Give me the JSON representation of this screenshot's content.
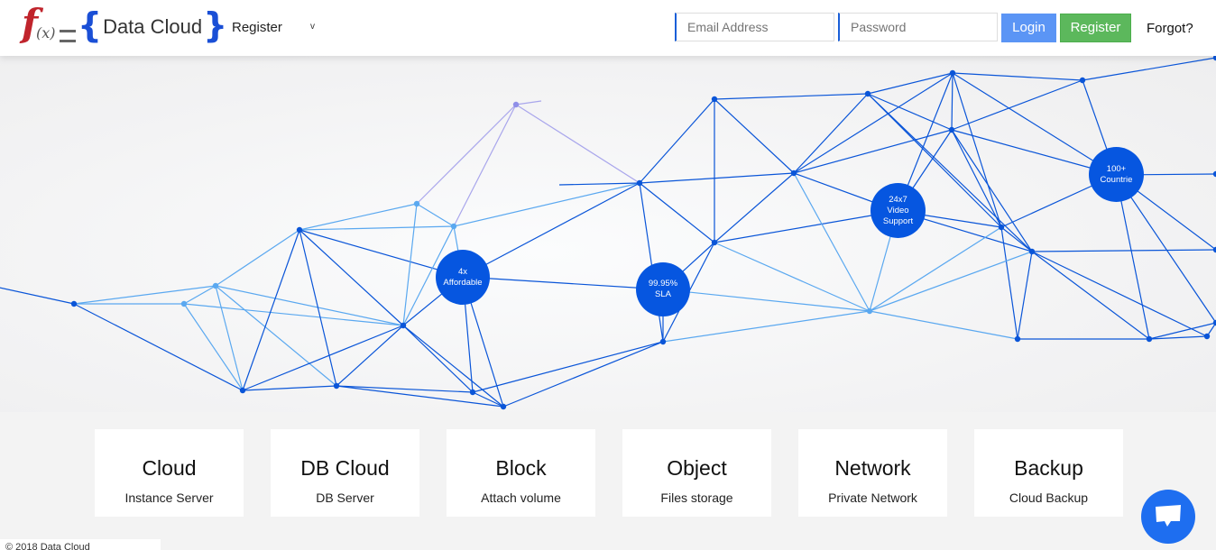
{
  "header": {
    "brand": {
      "open_brace": "{",
      "name": "Data Cloud",
      "close_brace": "}",
      "logo_f": "f",
      "logo_x": "(x)"
    },
    "nav": {
      "register_label": "Register",
      "chevron": "⌄"
    },
    "login_form": {
      "email_placeholder": "Email Address",
      "password_placeholder": "Password",
      "login_label": "Login",
      "register_label": "Register",
      "forgot_label": "Forgot?"
    }
  },
  "hero": {
    "bubbles": [
      {
        "line1": "4x",
        "line2": "Affordable",
        "line3": ""
      },
      {
        "line1": "99.95%",
        "line2": "SLA",
        "line3": ""
      },
      {
        "line1": "24x7",
        "line2": "Video",
        "line3": "Support"
      },
      {
        "line1": "100+",
        "line2": "Countrie",
        "line3": ""
      }
    ],
    "colors": {
      "bubble": "#0656e0",
      "line": "#0a55d8",
      "light_line": "#5aa8f0",
      "purple_node": "#8f8fe8"
    }
  },
  "services": [
    {
      "title": "Cloud",
      "subtitle": "Instance Server"
    },
    {
      "title": "DB Cloud",
      "subtitle": "DB Server"
    },
    {
      "title": "Block",
      "subtitle": "Attach volume"
    },
    {
      "title": "Object",
      "subtitle": "Files storage"
    },
    {
      "title": "Network",
      "subtitle": "Private Network"
    },
    {
      "title": "Backup",
      "subtitle": "Cloud Backup"
    }
  ],
  "footer": {
    "copyright": "© 2018 Data Cloud"
  },
  "chat": {
    "icon": "chat-bubble-icon"
  }
}
